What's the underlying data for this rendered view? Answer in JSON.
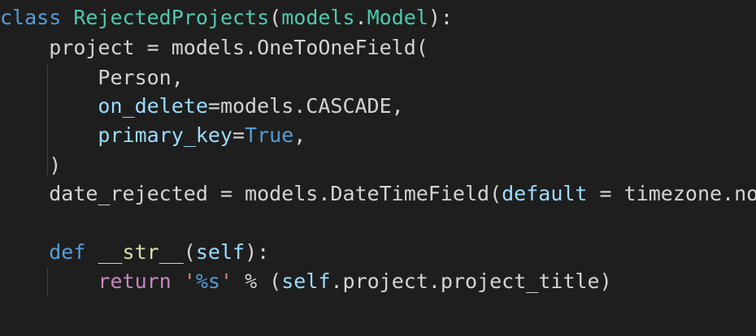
{
  "code": {
    "line1": {
      "kw_class": "class",
      "class_name": "RejectedProjects",
      "open_paren": "(",
      "base_module": "models",
      "dot": ".",
      "base_class": "Model",
      "close": "):"
    },
    "line2": {
      "text": "project = models.OneToOneField("
    },
    "line3": {
      "text": "Person,"
    },
    "line4": {
      "param": "on_delete",
      "rest": "=models.CASCADE,"
    },
    "line5": {
      "param": "primary_key",
      "eq": "=",
      "value": "True",
      "comma": ","
    },
    "line6": {
      "text": ")"
    },
    "line7": {
      "pre": "date_rejected = models.DateTimeField(",
      "param": "default",
      "post": " = timezone.now)"
    },
    "line9": {
      "kw_def": "def",
      "fn_name": "__str__",
      "open": "(",
      "self": "self",
      "close": "):"
    },
    "line10": {
      "kw_return": "return",
      "quote_open": "'",
      "fmt": "%s",
      "quote_close": "'",
      "op": " % (",
      "self": "self",
      "rest": ".project.project_title)"
    }
  },
  "colors": {
    "background": "#1e1e1e",
    "keyword": "#569cd6",
    "class_name": "#4ec9b0",
    "parameter": "#9cdcfe",
    "function": "#dcdcaa",
    "string": "#ce9178",
    "control_keyword": "#c586c0",
    "default_text": "#d4d4d4"
  }
}
